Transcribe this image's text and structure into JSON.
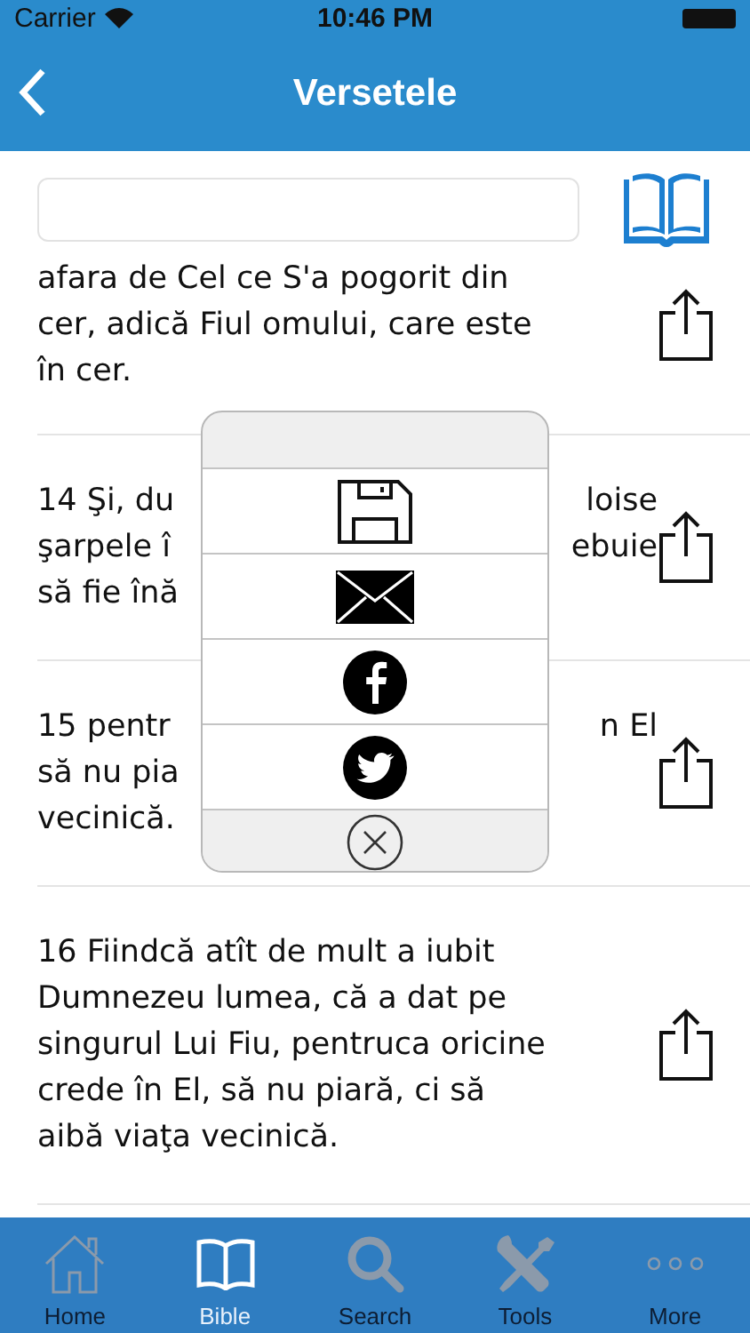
{
  "status_bar": {
    "carrier": "Carrier",
    "time": "10:46 PM"
  },
  "nav": {
    "title": "Versetele"
  },
  "verses": [
    {
      "lines": [
        {
          "left": "afara de Cel ce S'a pogorit din"
        },
        {
          "left": "cer, adică Fiul omului, care este"
        },
        {
          "left": "în cer."
        }
      ]
    },
    {
      "lines": [
        {
          "left": "14 Şi, du",
          "right": "loise"
        },
        {
          "left": "şarpele î",
          "right": "ebuie"
        },
        {
          "left": "să fie înă"
        }
      ]
    },
    {
      "lines": [
        {
          "left": "15 pentr",
          "right": "n El"
        },
        {
          "left": "să nu pia"
        },
        {
          "left": "vecinică."
        }
      ]
    },
    {
      "lines": [
        {
          "left": "16 Fiindcă atît de mult a iubit"
        },
        {
          "left": "Dumnezeu lumea, că a dat pe"
        },
        {
          "left": "singurul Lui Fiu, pentruca oricine"
        },
        {
          "left": "crede în El, să nu piară, ci să"
        },
        {
          "left": "aibă viaţa vecinică."
        }
      ]
    }
  ],
  "popup": {
    "items": [
      {
        "kind": "save"
      },
      {
        "kind": "email"
      },
      {
        "kind": "facebook"
      },
      {
        "kind": "twitter"
      },
      {
        "kind": "close"
      }
    ]
  },
  "tabs": [
    {
      "kind": "home",
      "label": "Home",
      "selected": false
    },
    {
      "kind": "bible",
      "label": "Bible",
      "selected": true
    },
    {
      "kind": "search",
      "label": "Search",
      "selected": false
    },
    {
      "kind": "tools",
      "label": "Tools",
      "selected": false
    },
    {
      "kind": "more",
      "label": "More",
      "selected": false
    }
  ]
}
